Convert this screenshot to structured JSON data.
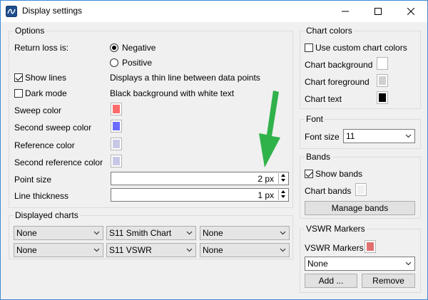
{
  "window": {
    "title": "Display settings"
  },
  "options": {
    "title": "Options",
    "return_loss_label": "Return loss is:",
    "negative_label": "Negative",
    "positive_label": "Positive",
    "show_lines_label": "Show lines",
    "show_lines_desc": "Displays a thin line between data points",
    "dark_mode_label": "Dark mode",
    "dark_mode_desc": "Black background with white text",
    "sweep_color_label": "Sweep color",
    "second_sweep_color_label": "Second sweep color",
    "reference_color_label": "Reference color",
    "second_reference_color_label": "Second reference color",
    "point_size_label": "Point size",
    "point_size_value": "2 px",
    "line_thickness_label": "Line thickness",
    "line_thickness_value": "1 px",
    "colors": {
      "sweep": "#ff6b6b",
      "second_sweep": "#6b6bff",
      "reference": "#c8c8e6",
      "second_reference": "#c8c8e6"
    }
  },
  "displayed_charts": {
    "title": "Displayed charts",
    "row1": [
      "None",
      "S11 Smith Chart",
      "None"
    ],
    "row2": [
      "None",
      "S11 VSWR",
      "None"
    ]
  },
  "chart_colors": {
    "title": "Chart colors",
    "use_custom_label": "Use custom chart colors",
    "background_label": "Chart background",
    "foreground_label": "Chart foreground",
    "text_label": "Chart text",
    "colors": {
      "background": "#ffffff",
      "foreground": "#d0d0d0",
      "text": "#000000"
    }
  },
  "font": {
    "title": "Font",
    "font_size_label": "Font size",
    "font_size_value": "11"
  },
  "bands": {
    "title": "Bands",
    "show_bands_label": "Show bands",
    "chart_bands_label": "Chart bands",
    "manage_label": "Manage bands",
    "chart_bands_color": "#f0f0f0"
  },
  "vswr_markers": {
    "title": "VSWR Markers",
    "label": "VSWR Markers",
    "color": "#e07070",
    "select_value": "None",
    "add_label": "Add ...",
    "remove_label": "Remove"
  },
  "annotation": {
    "arrow_color": "#2fb24a"
  }
}
